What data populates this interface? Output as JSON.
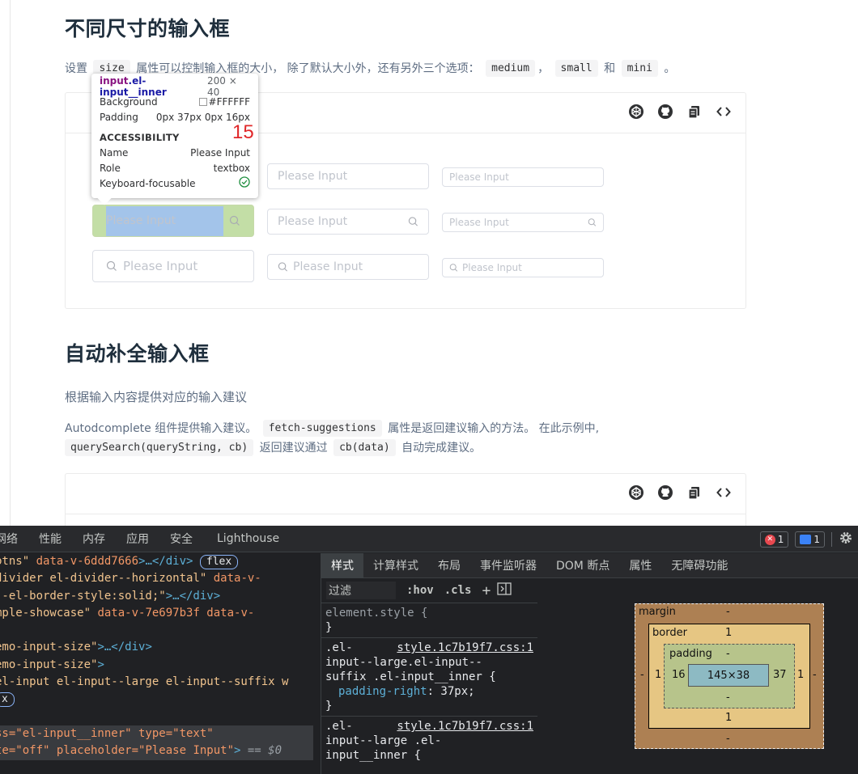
{
  "page": {
    "section1_title": "不同尺寸的输入框",
    "section1_desc": {
      "p1": "设置",
      "code_size": "size",
      "p2": "属性可以控制输入框的大小， 除了默认大小外，还有另外三个选项：",
      "code_medium": "medium",
      "sep1": "，",
      "code_small": "small",
      "and": "和",
      "code_mini": "mini",
      "end": "。"
    },
    "placeholder": "Please Input",
    "section2_title": "自动补全输入框",
    "section2_subtitle": "根据输入内容提供对应的输入建议",
    "section2_desc": {
      "l1_p1": "Autodcomplete 组件提供输入建议。",
      "code_fetch": "fetch-suggestions",
      "l1_p2": "属性是返回建议输入的方法。 在此示例中,",
      "code_query": "querySearch(queryString, cb)",
      "l2_p1": "返回建议通过",
      "code_cb": "cb(data)",
      "l2_p2": "自动完成建议。"
    },
    "toolbar_icons": [
      "codepen-icon",
      "github-icon",
      "copy-icon",
      "code-icon"
    ]
  },
  "tooltip": {
    "selector_tag": "input",
    "selector_class": ".el-input__inner",
    "size": "200 × 40",
    "background_label": "Background",
    "background_value": "#FFFFFF",
    "padding_label": "Padding",
    "padding_value": "0px 37px 0px 16px",
    "accessibility_heading": "ACCESSIBILITY",
    "name_label": "Name",
    "name_value": "Please Input",
    "role_label": "Role",
    "role_value": "textbox",
    "focusable_label": "Keyboard-focusable",
    "annotation_number": "15"
  },
  "devtools": {
    "tabs": [
      "网络",
      "性能",
      "内存",
      "应用",
      "安全",
      "Lighthouse"
    ],
    "error_count": "1",
    "message_count": "1",
    "elements_lines": [
      {
        "a": "btns\"",
        "b": " data-v-6ddd7666",
        "c": ">…</div>",
        "badge": "flex"
      },
      {
        "a": "divider el-divider--horizontal\"",
        "b": " data-v-",
        "c": ""
      },
      {
        "a": "--el-border-style:solid;\"",
        "b": "",
        "c": ">…</div>"
      },
      {
        "a": "mple-showcase\"",
        "b": " data-v-7e697b3f data-v-",
        "c": ""
      },
      {
        "a": "",
        "b": "",
        "c": ""
      },
      {
        "a": "emo-input-size\"",
        "b": "",
        "c": ">…</div>"
      },
      {
        "a": "emo-input-size\"",
        "b": "",
        "c": ">"
      },
      {
        "a": "el-input el-input--large el-input--suffix w",
        "b": "",
        "c": ""
      },
      {
        "a": "",
        "b": "",
        "c": "",
        "badge": "x"
      },
      {
        "a": "",
        "b": "",
        "c": ""
      },
      {
        "a": "ss=\"el-input__inner\"",
        "b": " type=\"text\"",
        "c": ""
      },
      {
        "a": "te=\"off\"",
        "b": " placeholder=\"Please Input\"",
        "c": ">",
        "suffix": " == $0"
      }
    ],
    "styles_tabs": [
      "样式",
      "计算样式",
      "布局",
      "事件监听器",
      "DOM 断点",
      "属性",
      "无障碍功能"
    ],
    "filter_placeholder": "过滤",
    "hov": ":hov",
    "cls": ".cls",
    "plus": "+",
    "element_style": "element.style {",
    "close_brace": "}",
    "rule1_link": "style.1c7b19f7.css:1",
    "rule1_sel1": ".el-",
    "rule1_sel2": "input--large.el-input--",
    "rule1_sel3": "suffix .el-input__inner {",
    "rule1_prop": "padding-right",
    "rule1_val": ": 37px;",
    "rule2_link": "style.1c7b19f7.css:1",
    "rule2_sel1": ".el-",
    "rule2_sel2": "input--large .el-",
    "rule2_sel3": "input__inner {",
    "boxmodel": {
      "margin_label": "margin",
      "margin_top": "-",
      "margin_bottom": "-",
      "margin_left": "-",
      "margin_right": "-",
      "border_label": "border",
      "border_top": "1",
      "border_bottom": "1",
      "border_left": "1",
      "border_right": "1",
      "padding_label": "padding",
      "padding_top": "-",
      "padding_bottom": "-",
      "padding_left": "16",
      "padding_right": "37",
      "content": "145×38"
    }
  }
}
